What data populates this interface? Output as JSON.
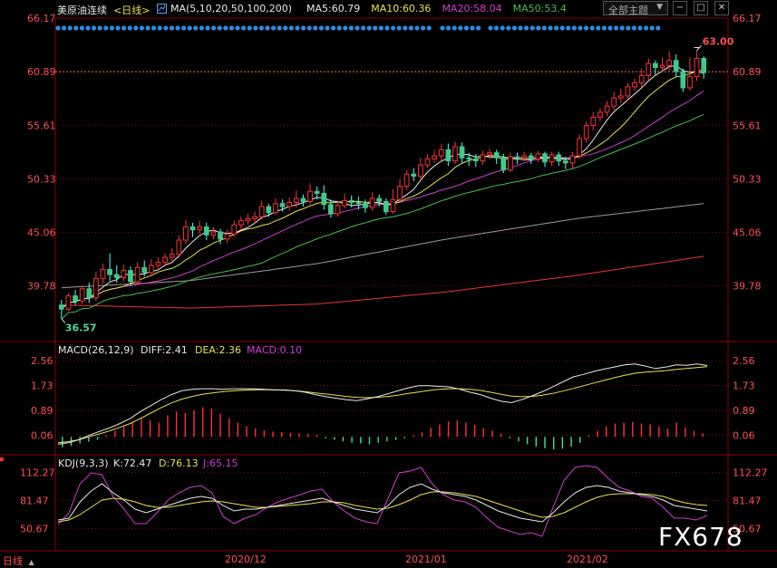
{
  "header": {
    "symbol": "美原油连续",
    "period_tag": "<日线>",
    "ma_label": "MA(5,10,20,50,100,200)",
    "ma_values": [
      {
        "label": "MA5:60.79",
        "color": "#e8e8e8"
      },
      {
        "label": "MA10:60.36",
        "color": "#e6e34a"
      },
      {
        "label": "MA20:58.04",
        "color": "#d23cd2"
      },
      {
        "label": "MA50:53.4",
        "color": "#43c04a"
      }
    ],
    "theme_button": "全部主题",
    "theme_arrow": "▼"
  },
  "window_buttons": {
    "minimize": "−",
    "maximize": "□",
    "close": "✕"
  },
  "price_panel": {
    "axis_labels": [
      "66.17",
      "60.89",
      "55.61",
      "50.33",
      "45.06",
      "39.78"
    ],
    "high_label": "63.00",
    "low_label": "36.57",
    "current_price_line": 60.89
  },
  "macd_panel": {
    "title": "MACD(26,12,9)",
    "diff": "DIFF:2.41",
    "dea": "DEA:2.36",
    "macd": "MACD:0.10",
    "axis_labels": [
      "2.56",
      "1.73",
      "0.89",
      "0.06"
    ]
  },
  "kdj_panel": {
    "title": "KDJ(9,3,3)",
    "k": "K:72.47",
    "d": "D:76.13",
    "j": "J:65.15",
    "axis_labels": [
      "112.27",
      "81.47",
      "50.67"
    ]
  },
  "x_axis": {
    "labels": [
      "2020/12",
      "2021/01",
      "2021/02"
    ]
  },
  "period_button": "日线",
  "period_arrow": "▲",
  "watermark": "FX678",
  "colors": {
    "up": "#ff3232",
    "down": "#54ffff",
    "down_fill": "#3fc98a",
    "ma5": "#e8e8e8",
    "ma10": "#e6e34a",
    "ma20": "#d23cd2",
    "ma50": "#43c04a",
    "ma100": "#9a9a9a",
    "ma200": "#e8382a",
    "axis_text": "#ff5050",
    "grid": "#7a1010"
  },
  "chart_data": {
    "type": "candlestick",
    "x_range": [
      "2020-11-02",
      "2021-03-05"
    ],
    "price_ylim": [
      36.0,
      66.17
    ],
    "candles": [
      [
        37.9,
        37.5,
        38.4,
        36.57
      ],
      [
        37.5,
        38.8,
        39.1,
        37.3
      ],
      [
        38.8,
        38.3,
        39.4,
        37.9
      ],
      [
        38.3,
        39.5,
        39.8,
        38.0
      ],
      [
        39.5,
        38.6,
        40.1,
        38.1
      ],
      [
        38.6,
        40.5,
        41.2,
        38.3
      ],
      [
        40.5,
        41.4,
        42.0,
        40.0
      ],
      [
        41.4,
        40.9,
        43.0,
        40.3
      ],
      [
        40.9,
        40.6,
        41.8,
        40.1
      ],
      [
        40.6,
        41.3,
        41.9,
        40.2
      ],
      [
        41.3,
        40.2,
        41.7,
        39.8
      ],
      [
        40.2,
        41.6,
        42.1,
        39.9
      ],
      [
        41.6,
        41.1,
        42.3,
        40.7
      ],
      [
        41.1,
        41.8,
        42.4,
        40.8
      ],
      [
        41.8,
        42.1,
        42.6,
        41.5
      ],
      [
        42.1,
        42.6,
        43.0,
        41.7
      ],
      [
        42.6,
        42.9,
        43.5,
        42.2
      ],
      [
        42.9,
        44.3,
        44.8,
        42.5
      ],
      [
        44.3,
        45.6,
        46.3,
        43.9
      ],
      [
        45.6,
        45.3,
        46.0,
        44.6
      ],
      [
        45.3,
        45.6,
        46.2,
        44.9
      ],
      [
        45.6,
        44.8,
        46.0,
        44.3
      ],
      [
        44.8,
        45.1,
        45.6,
        44.4
      ],
      [
        45.1,
        44.4,
        45.4,
        43.9
      ],
      [
        44.4,
        44.9,
        45.3,
        44.0
      ],
      [
        44.9,
        45.8,
        46.2,
        44.6
      ],
      [
        45.8,
        46.2,
        46.6,
        45.3
      ],
      [
        46.2,
        46.4,
        46.9,
        45.8
      ],
      [
        46.4,
        46.6,
        47.1,
        45.9
      ],
      [
        46.6,
        47.6,
        48.2,
        46.3
      ],
      [
        47.6,
        47.0,
        47.9,
        46.6
      ],
      [
        47.0,
        47.9,
        48.4,
        46.8
      ],
      [
        47.9,
        47.6,
        48.3,
        47.1
      ],
      [
        47.6,
        48.0,
        48.5,
        47.2
      ],
      [
        48.0,
        48.4,
        49.2,
        47.5
      ],
      [
        48.4,
        48.1,
        48.8,
        47.6
      ],
      [
        48.1,
        49.1,
        49.9,
        47.8
      ],
      [
        49.1,
        48.9,
        49.6,
        48.3
      ],
      [
        48.9,
        47.8,
        49.7,
        47.3
      ],
      [
        47.8,
        46.9,
        48.3,
        46.5
      ],
      [
        46.9,
        47.7,
        48.2,
        46.6
      ],
      [
        47.7,
        48.2,
        48.9,
        47.4
      ],
      [
        48.2,
        48.0,
        48.7,
        47.5
      ],
      [
        48.0,
        47.9,
        48.6,
        47.3
      ],
      [
        47.9,
        47.5,
        48.3,
        47.0
      ],
      [
        47.5,
        48.4,
        49.0,
        47.2
      ],
      [
        48.4,
        48.1,
        48.8,
        47.6
      ],
      [
        48.1,
        47.1,
        48.4,
        46.8
      ],
      [
        47.1,
        48.3,
        49.3,
        46.9
      ],
      [
        48.3,
        49.6,
        50.3,
        48.1
      ],
      [
        49.6,
        50.8,
        51.2,
        49.2
      ],
      [
        50.8,
        50.6,
        51.4,
        50.1
      ],
      [
        50.6,
        51.7,
        52.4,
        50.3
      ],
      [
        51.7,
        52.3,
        52.8,
        51.4
      ],
      [
        52.3,
        52.6,
        53.2,
        51.9
      ],
      [
        52.6,
        53.2,
        53.8,
        52.1
      ],
      [
        53.2,
        52.1,
        53.8,
        51.6
      ],
      [
        52.1,
        53.5,
        54.0,
        51.8
      ],
      [
        53.5,
        52.4,
        53.9,
        51.9
      ],
      [
        52.4,
        52.3,
        52.9,
        51.6
      ],
      [
        52.3,
        52.1,
        52.8,
        51.5
      ],
      [
        52.1,
        52.7,
        53.1,
        51.7
      ],
      [
        52.7,
        52.9,
        53.3,
        52.3
      ],
      [
        52.9,
        52.4,
        53.2,
        51.8
      ],
      [
        52.4,
        51.2,
        52.8,
        50.9
      ],
      [
        51.2,
        52.5,
        52.9,
        51.0
      ],
      [
        52.5,
        52.4,
        52.9,
        51.8
      ],
      [
        52.4,
        52.6,
        53.0,
        52.1
      ],
      [
        52.6,
        52.3,
        52.9,
        51.8
      ],
      [
        52.3,
        52.8,
        53.1,
        52.0
      ],
      [
        52.8,
        52.0,
        53.0,
        51.5
      ],
      [
        52.0,
        52.7,
        53.0,
        51.6
      ],
      [
        52.7,
        52.1,
        53.0,
        51.6
      ],
      [
        52.1,
        51.9,
        52.5,
        51.3
      ],
      [
        51.9,
        52.6,
        53.0,
        51.4
      ],
      [
        52.6,
        54.3,
        54.7,
        52.3
      ],
      [
        54.3,
        55.6,
        56.0,
        53.9
      ],
      [
        55.6,
        56.4,
        56.9,
        55.1
      ],
      [
        56.4,
        56.9,
        57.3,
        56.0
      ],
      [
        56.9,
        57.5,
        58.0,
        56.5
      ],
      [
        57.5,
        58.3,
        58.9,
        57.1
      ],
      [
        58.3,
        58.5,
        59.2,
        57.8
      ],
      [
        58.5,
        59.4,
        59.8,
        58.0
      ],
      [
        59.4,
        59.8,
        60.2,
        59.0
      ],
      [
        59.8,
        60.5,
        61.2,
        59.4
      ],
      [
        60.5,
        61.7,
        62.2,
        60.1
      ],
      [
        61.7,
        61.3,
        62.0,
        60.6
      ],
      [
        61.3,
        61.5,
        62.3,
        60.9
      ],
      [
        61.5,
        62.0,
        62.9,
        61.0
      ],
      [
        62.0,
        60.9,
        62.6,
        60.4
      ],
      [
        60.9,
        59.3,
        61.2,
        58.9
      ],
      [
        59.3,
        60.4,
        62.3,
        59.0
      ],
      [
        60.4,
        62.2,
        63.0,
        60.0
      ],
      [
        62.2,
        60.8,
        62.4,
        60.2
      ]
    ],
    "ma_series": [
      {
        "name": "MA100",
        "values": [
          39.6,
          40.3,
          42.0,
          44.4,
          46.4,
          47.9
        ]
      },
      {
        "name": "MA200",
        "values": [
          37.9,
          37.6,
          38.0,
          39.2,
          40.8,
          42.7
        ]
      }
    ],
    "macd": {
      "ylim": [
        -0.45,
        2.75
      ],
      "hist": [
        -0.35,
        -0.3,
        -0.22,
        -0.16,
        -0.1,
        0.05,
        0.2,
        0.35,
        0.5,
        0.62,
        0.55,
        0.48,
        0.72,
        0.85,
        0.8,
        0.9,
        1.0,
        0.95,
        0.78,
        0.62,
        0.48,
        0.36,
        0.28,
        0.22,
        0.18,
        0.15,
        0.14,
        0.12,
        0.1,
        0.08,
        -0.05,
        -0.1,
        -0.15,
        -0.2,
        -0.22,
        -0.25,
        -0.2,
        -0.15,
        -0.1,
        -0.05,
        0.05,
        0.15,
        0.3,
        0.42,
        0.52,
        0.55,
        0.48,
        0.4,
        0.3,
        0.2,
        0.1,
        -0.05,
        -0.15,
        -0.25,
        -0.33,
        -0.38,
        -0.42,
        -0.4,
        -0.33,
        -0.2,
        0.05,
        0.2,
        0.35,
        0.45,
        0.48,
        0.5,
        0.45,
        0.42,
        0.35,
        0.28,
        0.48,
        0.32,
        0.2,
        0.12
      ],
      "diff": [
        -0.25,
        -0.2,
        -0.1,
        0.05,
        0.18,
        0.3,
        0.45,
        0.62,
        0.85,
        1.05,
        1.25,
        1.42,
        1.55,
        1.6,
        1.62,
        1.62,
        1.6,
        1.62,
        1.62,
        1.62,
        1.6,
        1.58,
        1.58,
        1.55,
        1.5,
        1.42,
        1.35,
        1.3,
        1.25,
        1.22,
        1.28,
        1.35,
        1.45,
        1.55,
        1.65,
        1.72,
        1.72,
        1.7,
        1.68,
        1.6,
        1.5,
        1.42,
        1.3,
        1.2,
        1.15,
        1.25,
        1.38,
        1.52,
        1.68,
        1.85,
        2.02,
        2.1,
        2.2,
        2.28,
        2.35,
        2.42,
        2.45,
        2.38,
        2.3,
        2.35,
        2.42,
        2.41,
        2.45,
        2.4
      ],
      "dea": [
        -0.2,
        -0.16,
        -0.1,
        0.0,
        0.1,
        0.2,
        0.32,
        0.45,
        0.62,
        0.8,
        0.98,
        1.14,
        1.27,
        1.36,
        1.43,
        1.48,
        1.52,
        1.55,
        1.57,
        1.58,
        1.59,
        1.58,
        1.57,
        1.55,
        1.52,
        1.48,
        1.44,
        1.4,
        1.36,
        1.33,
        1.32,
        1.33,
        1.36,
        1.4,
        1.46,
        1.51,
        1.56,
        1.6,
        1.62,
        1.62,
        1.6,
        1.56,
        1.5,
        1.43,
        1.37,
        1.35,
        1.36,
        1.4,
        1.46,
        1.54,
        1.63,
        1.72,
        1.81,
        1.9,
        1.99,
        2.07,
        2.14,
        2.18,
        2.2,
        2.23,
        2.27,
        2.3,
        2.33,
        2.36
      ]
    },
    "kdj": {
      "ylim": [
        28,
        124
      ],
      "k": [
        60,
        62,
        80,
        92,
        100,
        90,
        82,
        72,
        68,
        72,
        76,
        80,
        84,
        86,
        84,
        76,
        70,
        72,
        72,
        74,
        76,
        78,
        80,
        82,
        84,
        80,
        76,
        72,
        70,
        68,
        76,
        88,
        96,
        100,
        94,
        90,
        88,
        86,
        82,
        76,
        70,
        66,
        62,
        60,
        58,
        68,
        80,
        90,
        96,
        98,
        96,
        92,
        90,
        88,
        86,
        82,
        76,
        74,
        72,
        70
      ],
      "d": [
        58,
        60,
        66,
        74,
        82,
        84,
        83,
        80,
        76,
        74,
        74,
        76,
        78,
        80,
        81,
        80,
        78,
        76,
        74,
        74,
        75,
        76,
        77,
        78,
        80,
        80,
        79,
        76,
        74,
        72,
        73,
        77,
        82,
        88,
        91,
        91,
        90,
        88,
        86,
        82,
        78,
        74,
        70,
        66,
        63,
        64,
        68,
        74,
        80,
        85,
        88,
        89,
        89,
        89,
        88,
        86,
        82,
        79,
        77,
        76
      ],
      "j": [
        55,
        68,
        100,
        112,
        110,
        86,
        72,
        56,
        56,
        68,
        82,
        90,
        96,
        98,
        90,
        64,
        56,
        62,
        66,
        74,
        80,
        84,
        88,
        92,
        94,
        80,
        70,
        62,
        58,
        56,
        84,
        112,
        114,
        118,
        100,
        88,
        82,
        80,
        74,
        62,
        52,
        48,
        44,
        46,
        42,
        74,
        104,
        118,
        120,
        118,
        106,
        96,
        92,
        86,
        84,
        74,
        62,
        62,
        60,
        65
      ]
    },
    "dates": [
      "2020/12",
      "2021/01",
      "2021/02"
    ]
  }
}
